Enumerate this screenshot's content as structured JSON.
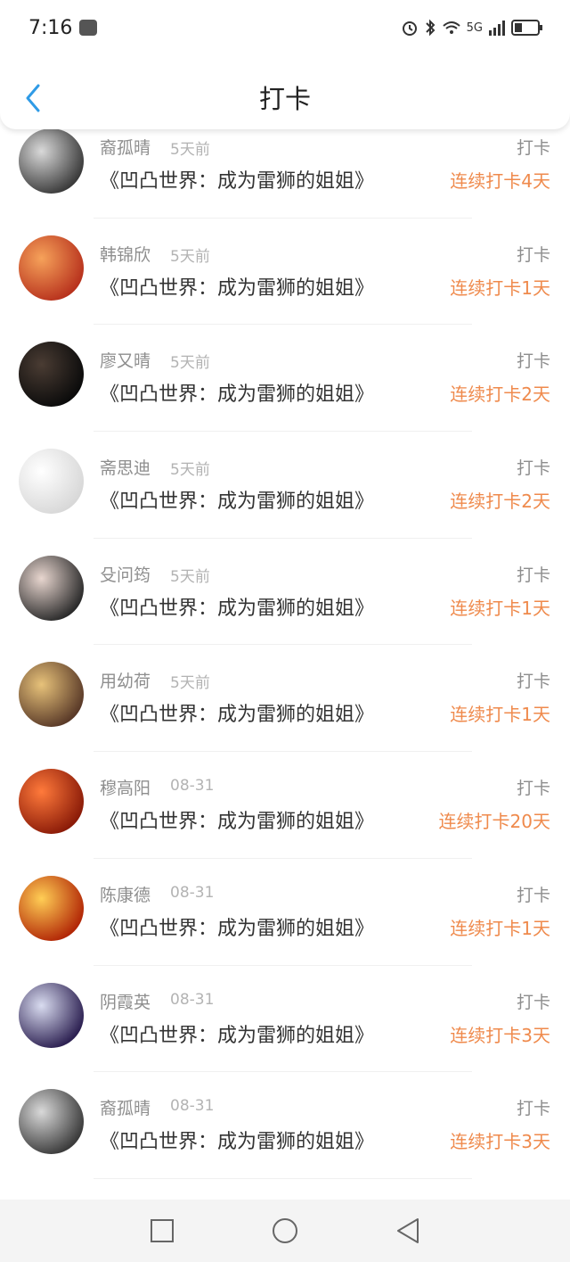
{
  "status": {
    "time": "7:16",
    "network": "5G"
  },
  "header": {
    "title": "打卡"
  },
  "items": [
    {
      "name": "裔孤晴",
      "time": "5天前",
      "book": "《凹凸世界：成为雷狮的姐姐》",
      "label": "打卡",
      "streak": "连续打卡4天",
      "avatar": [
        "#d9d9d9",
        "#3b3b3b"
      ]
    },
    {
      "name": "韩锦欣",
      "time": "5天前",
      "book": "《凹凸世界：成为雷狮的姐姐》",
      "label": "打卡",
      "streak": "连续打卡1天",
      "avatar": [
        "#f6a25a",
        "#b8321d"
      ]
    },
    {
      "name": "廖又晴",
      "time": "5天前",
      "book": "《凹凸世界：成为雷狮的姐姐》",
      "label": "打卡",
      "streak": "连续打卡2天",
      "avatar": [
        "#4a3c33",
        "#0b0b0b"
      ]
    },
    {
      "name": "斋思迪",
      "time": "5天前",
      "book": "《凹凸世界：成为雷狮的姐姐》",
      "label": "打卡",
      "streak": "连续打卡2天",
      "avatar": [
        "#ffffff",
        "#d8d8d8"
      ]
    },
    {
      "name": "殳问筠",
      "time": "5天前",
      "book": "《凹凸世界：成为雷狮的姐姐》",
      "label": "打卡",
      "streak": "连续打卡1天",
      "avatar": [
        "#e8d6cf",
        "#2b2b2b"
      ]
    },
    {
      "name": "用幼荷",
      "time": "5天前",
      "book": "《凹凸世界：成为雷狮的姐姐》",
      "label": "打卡",
      "streak": "连续打卡1天",
      "avatar": [
        "#e7c27a",
        "#5a3a28"
      ]
    },
    {
      "name": "穆高阳",
      "time": "08-31",
      "book": "《凹凸世界：成为雷狮的姐姐》",
      "label": "打卡",
      "streak": "连续打卡20天",
      "avatar": [
        "#ff7a3b",
        "#8b1b08"
      ]
    },
    {
      "name": "陈康德",
      "time": "08-31",
      "book": "《凹凸世界：成为雷狮的姐姐》",
      "label": "打卡",
      "streak": "连续打卡1天",
      "avatar": [
        "#ffce55",
        "#b22706"
      ]
    },
    {
      "name": "阴霞英",
      "time": "08-31",
      "book": "《凹凸世界：成为雷狮的姐姐》",
      "label": "打卡",
      "streak": "连续打卡3天",
      "avatar": [
        "#d9dcf0",
        "#2d2152"
      ]
    },
    {
      "name": "裔孤晴",
      "time": "08-31",
      "book": "《凹凸世界：成为雷狮的姐姐》",
      "label": "打卡",
      "streak": "连续打卡3天",
      "avatar": [
        "#d9d9d9",
        "#3b3b3b"
      ]
    }
  ],
  "colors": {
    "accent": "#2f9be6",
    "streak": "#ef8a4c"
  }
}
